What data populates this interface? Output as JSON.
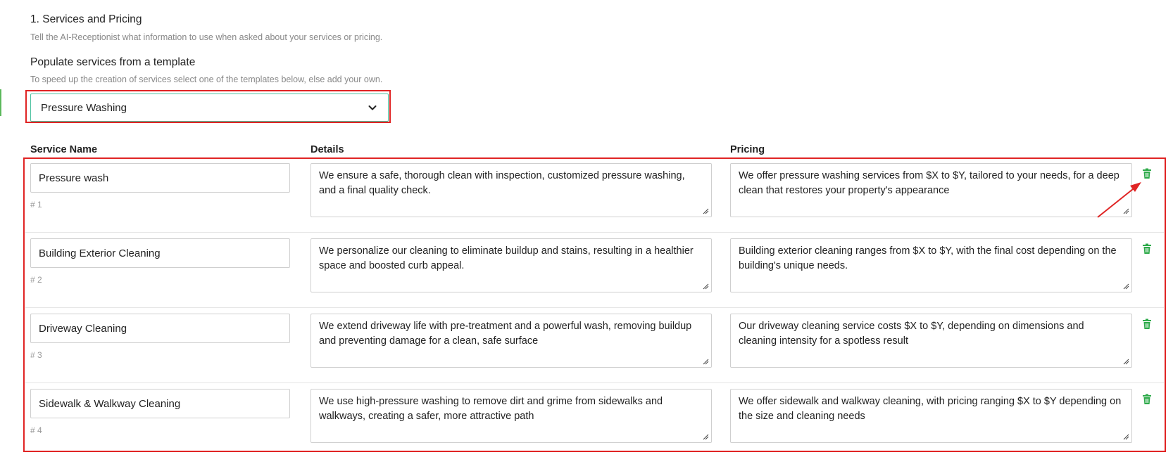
{
  "section": {
    "title": "1. Services and Pricing",
    "description": "Tell the AI-Receptionist what information to use when asked about your services or pricing."
  },
  "template": {
    "title": "Populate services from a template",
    "description": "To speed up the creation of services select one of the templates below, else add your own.",
    "selected": "Pressure Washing"
  },
  "columns": {
    "name": "Service Name",
    "details": "Details",
    "pricing": "Pricing"
  },
  "services": [
    {
      "name": "Pressure wash",
      "number": "# 1",
      "details": "We ensure a safe, thorough clean with inspection, customized pressure washing, and a final quality check.",
      "pricing": "We offer pressure washing services from $X to $Y, tailored to your needs, for a deep clean that restores your property's appearance"
    },
    {
      "name": "Building Exterior Cleaning",
      "number": "# 2",
      "details": "We personalize our cleaning to eliminate buildup and stains, resulting in a healthier space and boosted curb appeal.",
      "pricing": "Building exterior cleaning ranges from $X to $Y, with the final cost depending on the building's unique needs."
    },
    {
      "name": "Driveway Cleaning",
      "number": "# 3",
      "details": "We extend driveway life with pre-treatment and a powerful wash, removing buildup and preventing damage for a clean, safe surface",
      "pricing": "Our driveway cleaning service costs $X to $Y, depending on dimensions and cleaning intensity for a spotless result"
    },
    {
      "name": "Sidewalk & Walkway Cleaning",
      "number": "# 4",
      "details": "We use high-pressure washing to remove dirt and grime from sidewalks and walkways, creating a safer, more attractive path",
      "pricing": "We offer sidewalk and walkway cleaning, with pricing ranging $X to $Y depending on the size and cleaning needs"
    }
  ],
  "icons": {
    "delete": "trash-icon",
    "dropdown": "chevron-down-icon"
  },
  "colors": {
    "highlight": "#e02424",
    "trash": "#2eaa4a",
    "focus_border": "#4fc3a1"
  }
}
